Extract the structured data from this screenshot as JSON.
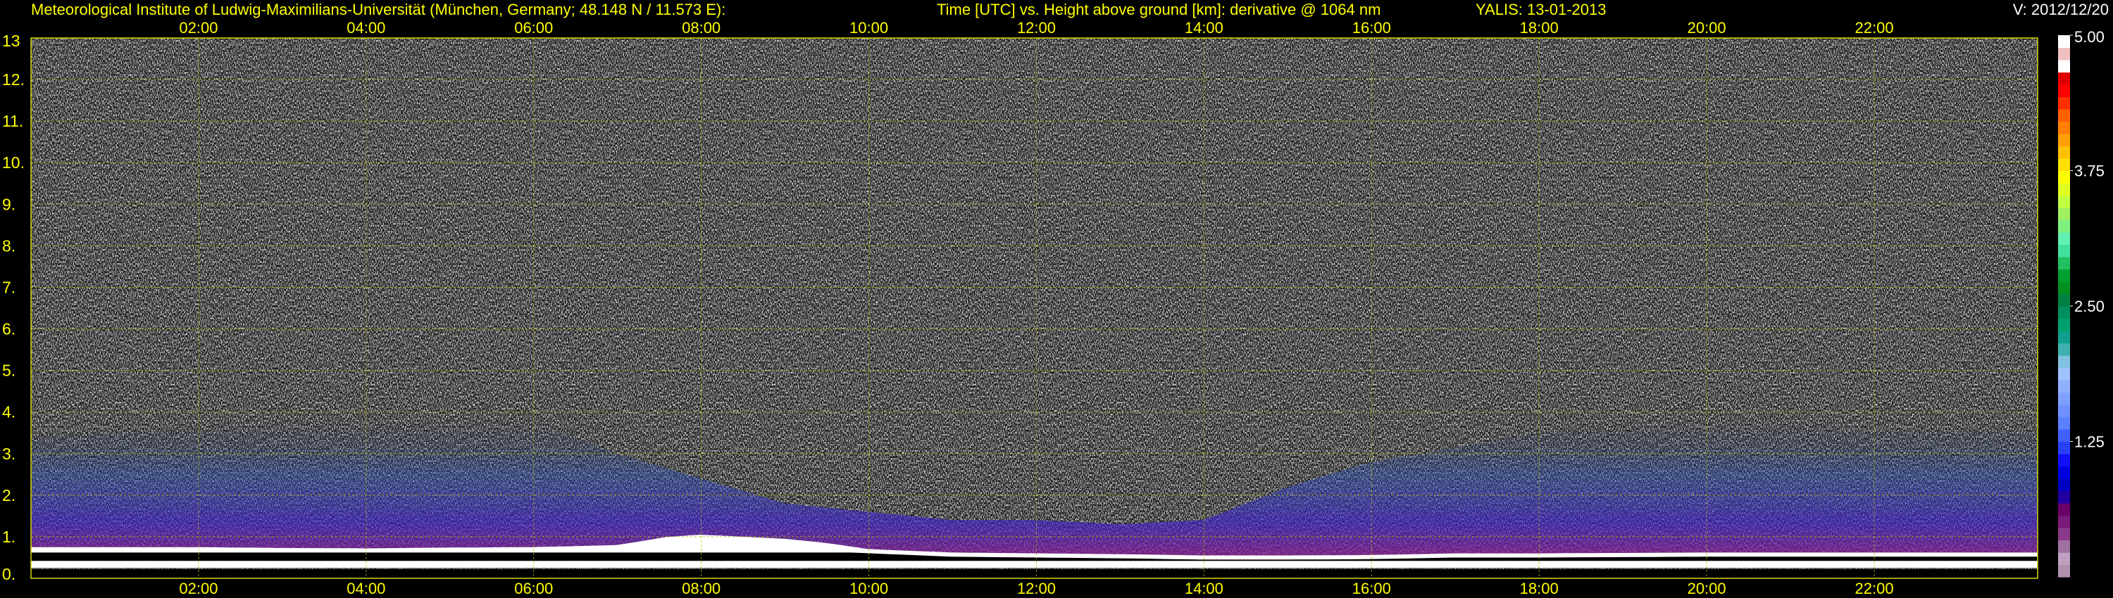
{
  "header": {
    "institute": "Meteorological Institute of Ludwig-Maximilians-Universität (München, Germany; 48.148 N / 11.573 E):",
    "axes_description": "Time [UTC] vs. Height above ground [km]: derivative @ 1064 nm",
    "instrument_date": "YALIS: 13-01-2013",
    "version": "V: 2012/12/20"
  },
  "colors": {
    "background": "#000000",
    "label_text": "#ffff00",
    "grid": "#b8b800",
    "noise_light": "#ffffff",
    "noise_dark": "#1a1a1a",
    "boundary_layer": "#ffffff"
  },
  "chart_data": {
    "type": "heatmap",
    "x_axis": {
      "unit": "UTC",
      "range_hours": [
        0.0,
        23.95
      ],
      "tick_labels": [
        "02:00",
        "04:00",
        "06:00",
        "08:00",
        "10:00",
        "12:00",
        "14:00",
        "16:00",
        "18:00",
        "20:00",
        "22:00"
      ],
      "tick_hours": [
        2,
        4,
        6,
        8,
        10,
        12,
        14,
        16,
        18,
        20,
        22
      ],
      "labels_on": [
        "top",
        "bottom"
      ]
    },
    "y_axis": {
      "unit": "km",
      "range": [
        0,
        13
      ],
      "ticks": [
        0,
        1,
        2,
        3,
        4,
        5,
        6,
        7,
        8,
        9,
        10,
        11,
        12,
        13
      ],
      "tick_labels": [
        "0.",
        "1.",
        "2.",
        "3.",
        "4.",
        "5.",
        "6.",
        "7.",
        "8.",
        "9.",
        "10.",
        "11.",
        "12.",
        "13"
      ]
    },
    "grid": true,
    "colorbar": {
      "position": "right",
      "range": [
        0,
        5
      ],
      "tick_labels": [
        "5.00",
        "3.75",
        "2.50",
        "1.25"
      ],
      "tick_values": [
        5.0,
        3.75,
        2.5,
        1.25
      ],
      "colors": [
        "#b090b0",
        "#c0a0c0",
        "#a070a0",
        "#8a3a8a",
        "#7a1a7a",
        "#6a006a",
        "#2000a0",
        "#0000c0",
        "#0000e0",
        "#1010ff",
        "#2a40ff",
        "#4060ff",
        "#5a80ff",
        "#7090ff",
        "#80a0ff",
        "#90b0ff",
        "#a0c0ff",
        "#80c0e0",
        "#40b0b0",
        "#10a090",
        "#00a070",
        "#009060",
        "#008040",
        "#009020",
        "#00a030",
        "#20c060",
        "#40e0a0",
        "#60f0b0",
        "#80f080",
        "#a0f060",
        "#c0ff40",
        "#e0ff20",
        "#ffff00",
        "#ffe000",
        "#ffc000",
        "#ffa000",
        "#ff8000",
        "#ff6000",
        "#ff3000",
        "#ff0000",
        "#e00000",
        "#ffffff",
        "#f0c0c0",
        "#ffffff"
      ]
    },
    "features": {
      "noise_top_km": 13,
      "aerosol_layer_top_km": [
        [
          0,
          3.4
        ],
        [
          2,
          3.6
        ],
        [
          4,
          3.8
        ],
        [
          6,
          3.8
        ],
        [
          7,
          3.0
        ],
        [
          8,
          2.4
        ],
        [
          9,
          1.8
        ],
        [
          10,
          1.6
        ],
        [
          11,
          1.4
        ],
        [
          12,
          1.4
        ],
        [
          13,
          1.3
        ],
        [
          14,
          1.4
        ],
        [
          15,
          2.2
        ],
        [
          16,
          2.8
        ],
        [
          18,
          3.5
        ],
        [
          20,
          3.7
        ],
        [
          22,
          3.6
        ],
        [
          23.95,
          3.5
        ]
      ],
      "surface_white_band_top_km": [
        [
          0,
          0.75
        ],
        [
          1,
          0.75
        ],
        [
          2,
          0.75
        ],
        [
          3,
          0.73
        ],
        [
          4,
          0.72
        ],
        [
          5,
          0.74
        ],
        [
          6,
          0.75
        ],
        [
          7,
          0.8
        ],
        [
          7.6,
          1.0
        ],
        [
          8,
          1.05
        ],
        [
          8.5,
          1.0
        ],
        [
          9,
          0.95
        ],
        [
          9.5,
          0.85
        ],
        [
          10,
          0.7
        ],
        [
          11,
          0.62
        ],
        [
          12,
          0.6
        ],
        [
          13,
          0.58
        ],
        [
          14,
          0.55
        ],
        [
          15,
          0.55
        ],
        [
          16,
          0.56
        ],
        [
          17,
          0.6
        ],
        [
          18,
          0.6
        ],
        [
          20,
          0.62
        ],
        [
          22,
          0.62
        ],
        [
          23.95,
          0.62
        ]
      ]
    }
  }
}
